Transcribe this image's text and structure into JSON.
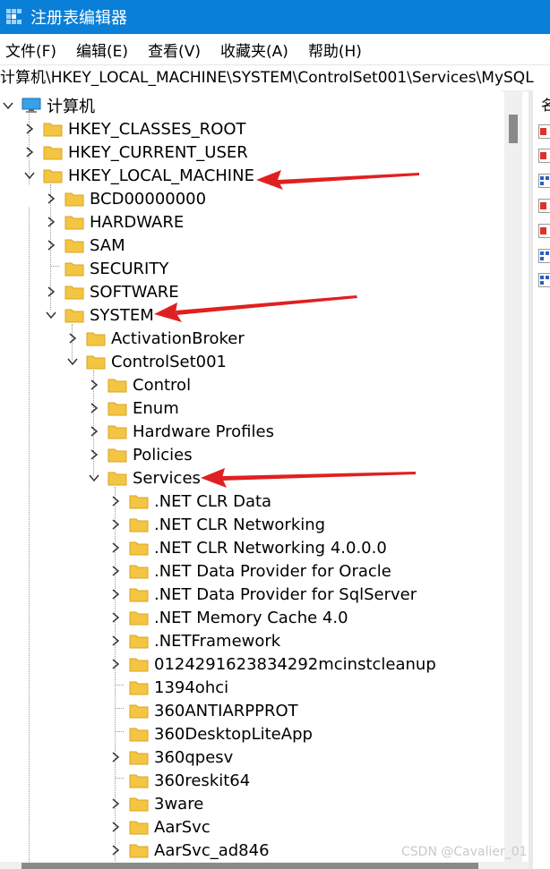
{
  "window": {
    "title": "注册表编辑器"
  },
  "menu": [
    "文件(F)",
    "编辑(E)",
    "查看(V)",
    "收藏夹(A)",
    "帮助(H)"
  ],
  "address": "计算机\\HKEY_LOCAL_MACHINE\\SYSTEM\\ControlSet001\\Services\\MySQL",
  "tree": {
    "root": "计算机",
    "hives": [
      "HKEY_CLASSES_ROOT",
      "HKEY_CURRENT_USER",
      "HKEY_LOCAL_MACHINE"
    ],
    "hklm_children": [
      "BCD00000000",
      "HARDWARE",
      "SAM",
      "SECURITY",
      "SOFTWARE",
      "SYSTEM"
    ],
    "system_children": [
      "ActivationBroker",
      "ControlSet001"
    ],
    "controlset_children": [
      "Control",
      "Enum",
      "Hardware Profiles",
      "Policies",
      "Services"
    ],
    "services_children": [
      ".NET CLR Data",
      ".NET CLR Networking",
      ".NET CLR Networking 4.0.0.0",
      ".NET Data Provider for Oracle",
      ".NET Data Provider for SqlServer",
      ".NET Memory Cache 4.0",
      ".NETFramework",
      "0124291623834292mcinstcleanup",
      "1394ohci",
      "360ANTIARPPROT",
      "360DesktopLiteApp",
      "360qpesv",
      "360reskit64",
      "3ware",
      "AarSvc",
      "AarSvc_ad846"
    ]
  },
  "right_pane": {
    "column_header": "名"
  },
  "watermark": "CSDN @Cavalier_01",
  "colors": {
    "titlebar": "#0a7fd8",
    "folder": "#f4c542",
    "arrow": "#e02020"
  }
}
